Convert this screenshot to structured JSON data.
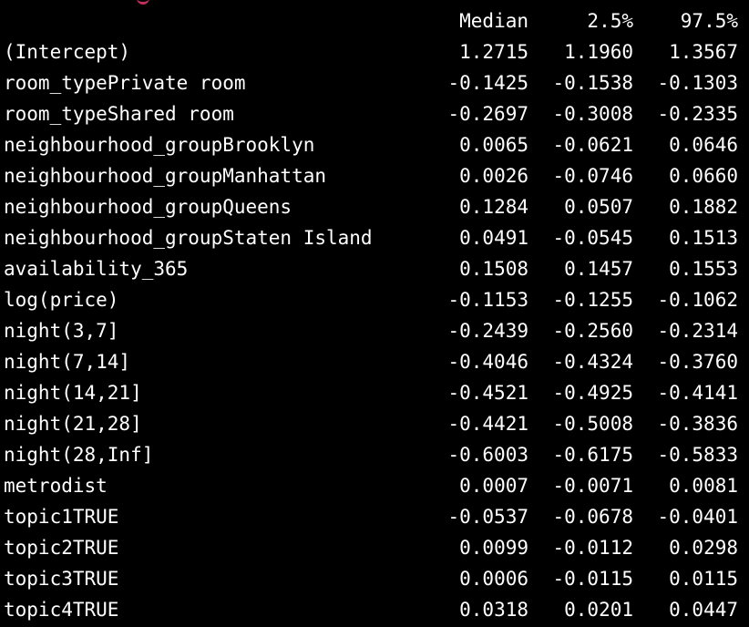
{
  "colors": {
    "background": "#000000",
    "text": "#ffffff",
    "accent_mark": "#c0305a"
  },
  "header": {
    "median": "Median",
    "p025": "2.5%",
    "p975": "97.5%"
  },
  "rows": [
    {
      "term": "(Intercept)",
      "median": "1.2715",
      "p025": "1.1960",
      "p975": "1.3567"
    },
    {
      "term": "room_typePrivate room",
      "median": "-0.1425",
      "p025": "-0.1538",
      "p975": "-0.1303"
    },
    {
      "term": "room_typeShared room",
      "median": "-0.2697",
      "p025": "-0.3008",
      "p975": "-0.2335"
    },
    {
      "term": "neighbourhood_groupBrooklyn",
      "median": "0.0065",
      "p025": "-0.0621",
      "p975": "0.0646"
    },
    {
      "term": "neighbourhood_groupManhattan",
      "median": "0.0026",
      "p025": "-0.0746",
      "p975": "0.0660"
    },
    {
      "term": "neighbourhood_groupQueens",
      "median": "0.1284",
      "p025": "0.0507",
      "p975": "0.1882"
    },
    {
      "term": "neighbourhood_groupStaten Island",
      "median": "0.0491",
      "p025": "-0.0545",
      "p975": "0.1513"
    },
    {
      "term": "availability_365",
      "median": "0.1508",
      "p025": "0.1457",
      "p975": "0.1553"
    },
    {
      "term": "log(price)",
      "median": "-0.1153",
      "p025": "-0.1255",
      "p975": "-0.1062"
    },
    {
      "term": "night(3,7]",
      "median": "-0.2439",
      "p025": "-0.2560",
      "p975": "-0.2314"
    },
    {
      "term": "night(7,14]",
      "median": "-0.4046",
      "p025": "-0.4324",
      "p975": "-0.3760"
    },
    {
      "term": "night(14,21]",
      "median": "-0.4521",
      "p025": "-0.4925",
      "p975": "-0.4141"
    },
    {
      "term": "night(21,28]",
      "median": "-0.4421",
      "p025": "-0.5008",
      "p975": "-0.3836"
    },
    {
      "term": "night(28,Inf]",
      "median": "-0.6003",
      "p025": "-0.6175",
      "p975": "-0.5833"
    },
    {
      "term": "metrodist",
      "median": "0.0007",
      "p025": "-0.0071",
      "p975": "0.0081"
    },
    {
      "term": "topic1TRUE",
      "median": "-0.0537",
      "p025": "-0.0678",
      "p975": "-0.0401"
    },
    {
      "term": "topic2TRUE",
      "median": "0.0099",
      "p025": "-0.0112",
      "p975": "0.0298"
    },
    {
      "term": "topic3TRUE",
      "median": "0.0006",
      "p025": "-0.0115",
      "p975": "0.0115"
    },
    {
      "term": "topic4TRUE",
      "median": "0.0318",
      "p025": "0.0201",
      "p975": "0.0447"
    }
  ]
}
